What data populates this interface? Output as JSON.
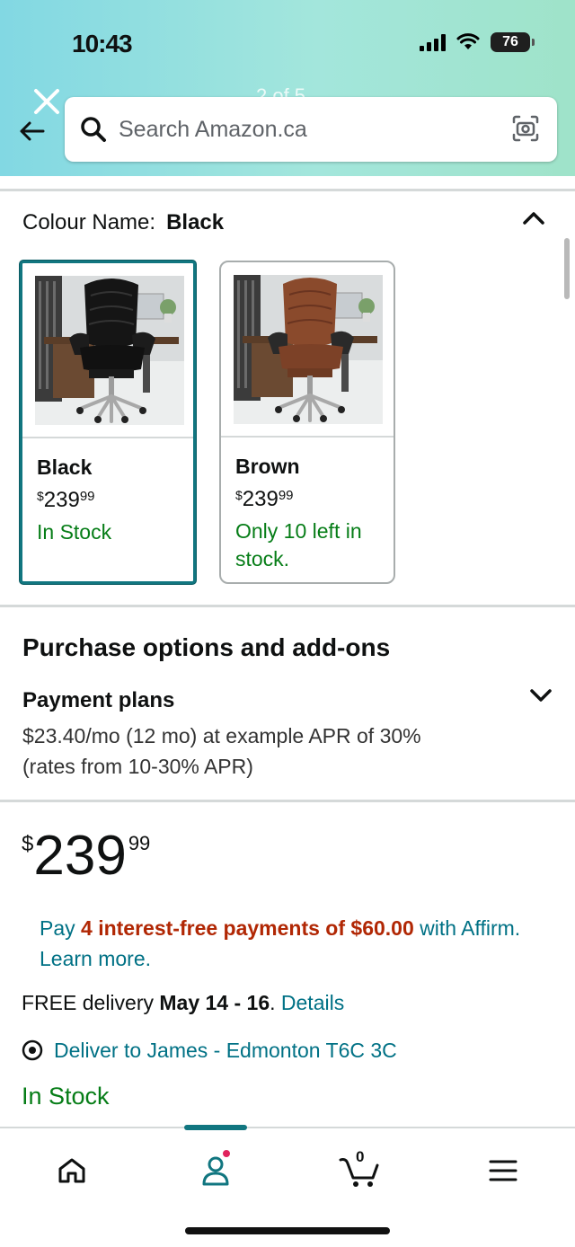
{
  "status_bar": {
    "time": "10:43",
    "battery": "76"
  },
  "header": {
    "page_counter": "2 of 5",
    "search": {
      "placeholder": "Search Amazon.ca"
    }
  },
  "colour": {
    "label": "Colour Name:",
    "selected": "Black",
    "options": [
      {
        "name": "Black",
        "price_currency": "$",
        "price_whole": "239",
        "price_fraction": "99",
        "stock": "In Stock",
        "selected": true
      },
      {
        "name": "Brown",
        "price_currency": "$",
        "price_whole": "239",
        "price_fraction": "99",
        "stock": "Only 10 left in stock.",
        "selected": false
      }
    ]
  },
  "purchase_options": {
    "title": "Purchase options and add-ons",
    "payment_plans": {
      "title": "Payment plans",
      "description": "$23.40/mo (12 mo) at example APR of 30% (rates from 10-30% APR)"
    }
  },
  "price": {
    "currency": "$",
    "whole": "239",
    "fraction": "99"
  },
  "affirm": {
    "prefix": "Pay ",
    "highlight": "4 interest-free payments of $60.00",
    "suffix": " with Affirm. Learn more."
  },
  "delivery": {
    "prefix": "FREE delivery ",
    "dates": "May 14 - 16",
    "separator": ". ",
    "details_link": "Details",
    "deliver_to": "Deliver to James - Edmonton T6C 3C"
  },
  "stock_status": "In Stock",
  "bottom_nav": {
    "items": [
      "home-icon",
      "account-icon",
      "cart-icon",
      "menu-icon"
    ],
    "cart_count": "0",
    "active_color": "#117680"
  },
  "colors": {
    "link": "#007185",
    "in_stock": "#067d17",
    "deal": "#b12704",
    "selected_border": "#117680"
  }
}
